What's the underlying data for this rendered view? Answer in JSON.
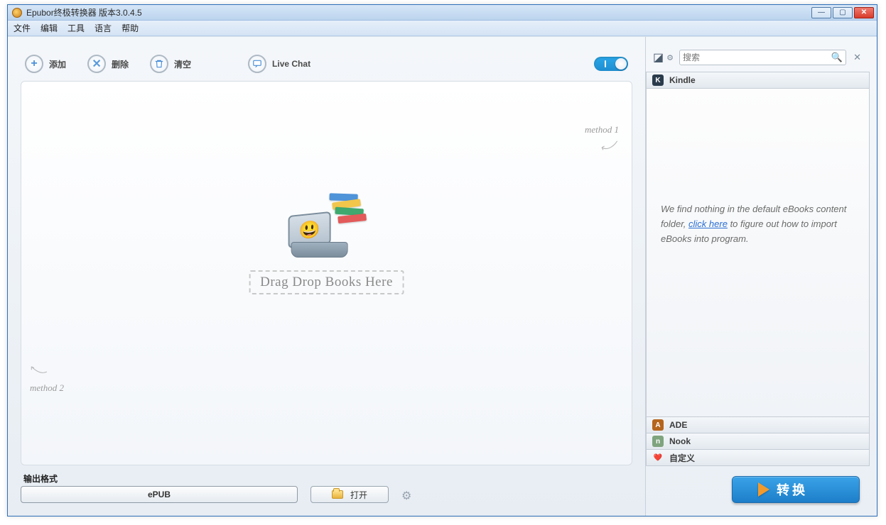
{
  "titlebar": {
    "title": "Epubor终极转换器 版本3.0.4.5"
  },
  "menu": {
    "file": "文件",
    "edit": "编辑",
    "tools": "工具",
    "language": "语言",
    "help": "帮助"
  },
  "toolbar": {
    "add": "添加",
    "delete": "删除",
    "clear": "清空",
    "livechat": "Live Chat"
  },
  "dropzone": {
    "label": "Drag Drop Books Here",
    "method1": "method 1",
    "method2": "method 2"
  },
  "output": {
    "group_label": "输出格式",
    "format": "ePUB",
    "open": "打开"
  },
  "search": {
    "placeholder": "搜索"
  },
  "sources": {
    "kindle": "Kindle",
    "ade": "ADE",
    "nook": "Nook",
    "custom": "自定义"
  },
  "empty_msg": {
    "part1": "We find nothing in the default eBooks content folder, ",
    "link": "click here",
    "part2": " to figure out how to import eBooks into program."
  },
  "convert": {
    "label": "转换"
  }
}
